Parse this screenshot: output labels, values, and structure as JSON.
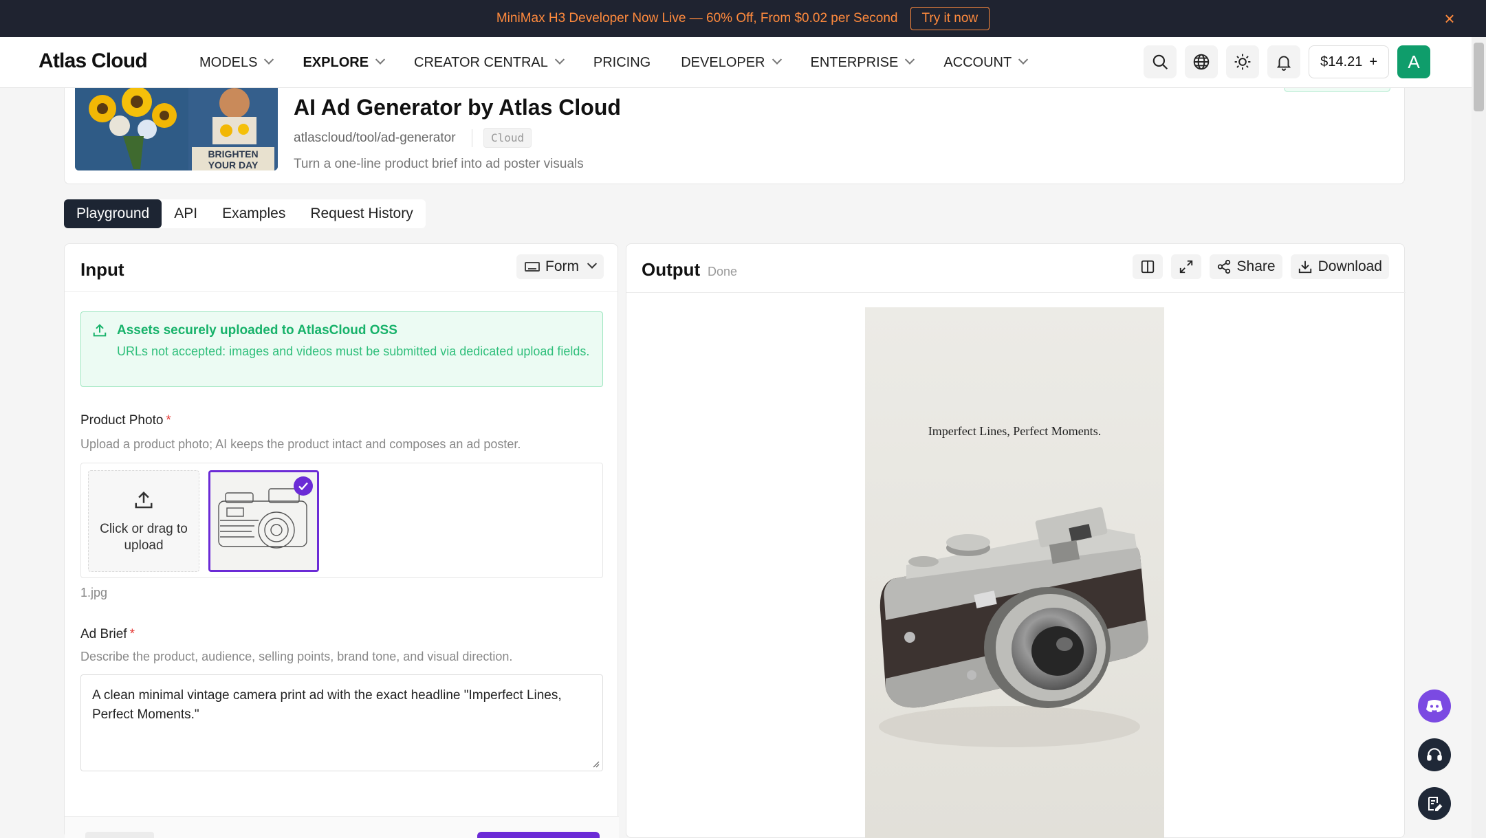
{
  "promo": {
    "text": "MiniMax H3 Developer Now Live — 60% Off, From $0.02 per Second",
    "cta": "Try it now"
  },
  "nav": {
    "logo": "Atlas Cloud",
    "items": [
      {
        "label": "MODELS",
        "dropdown": true
      },
      {
        "label": "EXPLORE",
        "dropdown": true,
        "active": true
      },
      {
        "label": "CREATOR CENTRAL",
        "dropdown": true
      },
      {
        "label": "PRICING",
        "dropdown": false
      },
      {
        "label": "DEVELOPER",
        "dropdown": true
      },
      {
        "label": "ENTERPRISE",
        "dropdown": true
      },
      {
        "label": "ACCOUNT",
        "dropdown": true
      }
    ],
    "balance": "$14.21",
    "balance_add": "+",
    "avatar_letter": "A"
  },
  "tool": {
    "title": "AI Ad Generator by Atlas Cloud",
    "slug": "atlascloud/tool/ad-generator",
    "tag": "Cloud",
    "description": "Turn a one-line product brief into ad poster visuals",
    "thumbnail_text": "BRIGHTEN YOUR DAY"
  },
  "tabs": [
    {
      "label": "Playground",
      "active": true
    },
    {
      "label": "API"
    },
    {
      "label": "Examples"
    },
    {
      "label": "Request History"
    }
  ],
  "input": {
    "title": "Input",
    "mode": "Form",
    "notice_title": "Assets securely uploaded to AtlasCloud OSS",
    "notice_body": "URLs not accepted: images and videos must be submitted via dedicated upload fields.",
    "photo_label": "Product Photo",
    "photo_hint": "Upload a product photo; AI keeps the product intact and composes an ad poster.",
    "upload_text": "Click or drag to upload",
    "file_name": "1.jpg",
    "brief_label": "Ad Brief",
    "brief_hint": "Describe the product, audience, selling points, brand tone, and visual direction.",
    "brief_value": "A clean minimal vintage camera print ad with the exact headline \"Imperfect Lines, Perfect Moments.\""
  },
  "output": {
    "title": "Output",
    "status": "Done",
    "share": "Share",
    "download": "Download",
    "poster_headline": "Imperfect Lines, Perfect Moments."
  },
  "colors": {
    "accent": "#6b2bd6",
    "success": "#17b26a",
    "promo_text": "#ff8a3d",
    "avatar": "#0f9d6b"
  }
}
